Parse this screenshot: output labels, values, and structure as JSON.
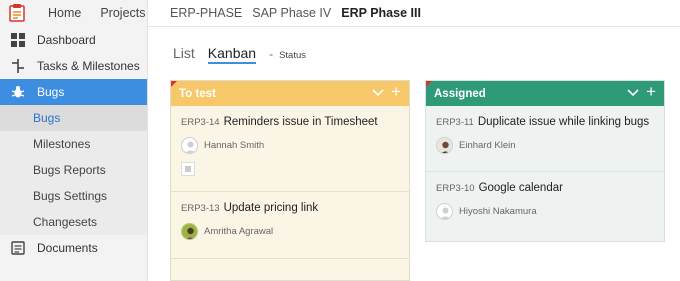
{
  "topbar": {
    "nav": [
      "Home",
      "Projects"
    ],
    "breadcrumbs": [
      "ERP-PHASE",
      "SAP Phase IV",
      "ERP Phase III"
    ]
  },
  "sidebar": {
    "items": [
      {
        "label": "Dashboard",
        "icon": "dashboard-icon"
      },
      {
        "label": "Tasks & Milestones",
        "icon": "tasks-icon"
      },
      {
        "label": "Bugs",
        "icon": "bug-icon",
        "active": true
      },
      {
        "label": "Documents",
        "icon": "documents-icon"
      }
    ],
    "sub_items": [
      {
        "label": "Bugs",
        "active": true
      },
      {
        "label": "Milestones"
      },
      {
        "label": "Bugs Reports"
      },
      {
        "label": "Bugs Settings"
      },
      {
        "label": "Changesets"
      }
    ]
  },
  "view": {
    "list_label": "List",
    "kanban_label": "Kanban",
    "dash": "-",
    "status_label": "Status"
  },
  "columns": [
    {
      "title": "To test",
      "color": "#f6c86a",
      "cards": [
        {
          "id": "ERP3-14",
          "title": "Reminders issue in Timesheet",
          "owner": "Hannah Smith"
        },
        {
          "id": "ERP3-13",
          "title": "Update pricing link",
          "owner": "Amritha Agrawal"
        }
      ]
    },
    {
      "title": "Assigned",
      "color": "#2f9a78",
      "cards": [
        {
          "id": "ERP3-11",
          "title": "Duplicate issue while linking bugs",
          "owner": "Einhard Klein"
        },
        {
          "id": "ERP3-10",
          "title": "Google calendar",
          "owner": "Hiyoshi Nakamura"
        }
      ]
    }
  ]
}
